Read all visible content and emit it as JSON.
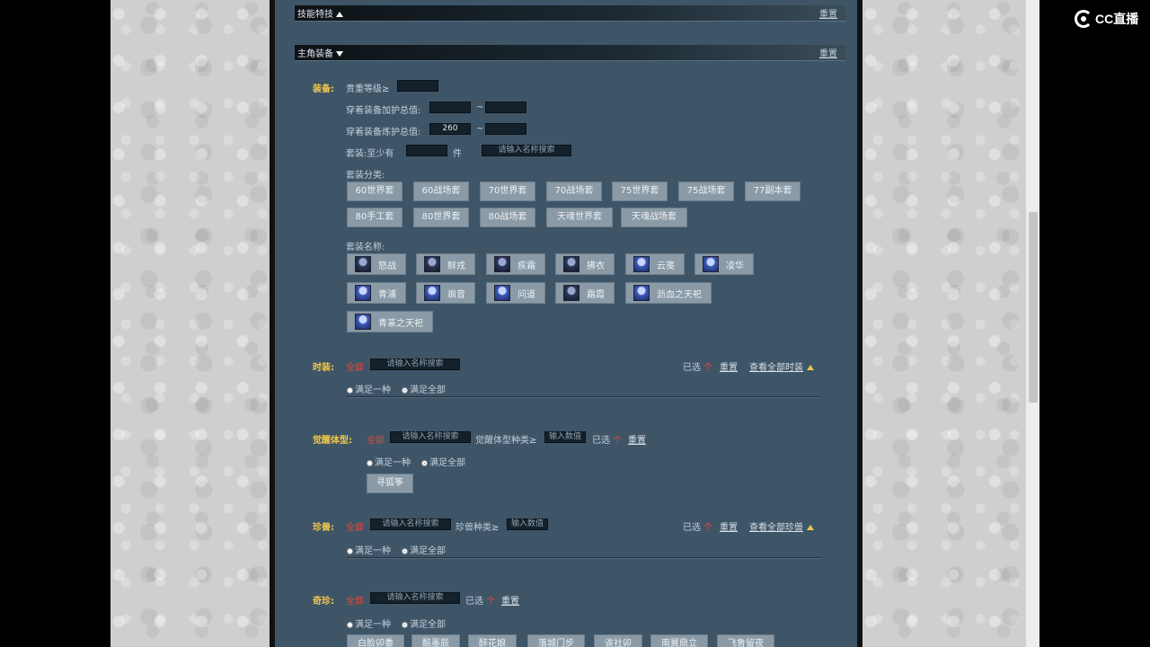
{
  "brand": {
    "name": "CC直播"
  },
  "sections": {
    "skills": {
      "title": "技能特技",
      "reset": "重置"
    },
    "equip": {
      "title": "主角装备",
      "reset": "重置"
    }
  },
  "equipment": {
    "label": "装备:",
    "row1": {
      "text": "贵重等级≥",
      "value": ""
    },
    "row2": {
      "text": "穿着装备加护总值:",
      "min": "",
      "sep": "~",
      "max": ""
    },
    "row3": {
      "text": "穿着装备炼护总值:",
      "min": "260",
      "sep": "~",
      "max": ""
    },
    "row4": {
      "text": "套装:至少有",
      "value": "",
      "unit": "件",
      "search_placeholder": "请输入名称搜索"
    },
    "category_label": "套装分类:",
    "categories": [
      "60世界套",
      "60战场套",
      "70世界套",
      "70战场套",
      "75世界套",
      "75战场套",
      "77副本套",
      "80手工套",
      "80世界套",
      "80战场套",
      "天魂世界套",
      "天魂战场套"
    ],
    "name_label": "套装名称:",
    "set_names": [
      "怒战",
      "鲜戎",
      "疾霜",
      "拂衣",
      "云笺",
      "凌华",
      "青浦",
      "飒音",
      "问道",
      "霜霞",
      "沥血之天祀",
      "青篆之天祀"
    ]
  },
  "fashion": {
    "label": "时装:",
    "all": "全部",
    "search_placeholder": "请输入名称搜索",
    "selected_prefix": "已选",
    "selected_count": "个",
    "reset": "重置",
    "view_all": "查看全部时装",
    "option_one": "满足一种",
    "option_all": "满足全部"
  },
  "awaken": {
    "label": "觉醒体型:",
    "all": "全部",
    "search_placeholder": "请输入名称搜索",
    "count_label": "觉醒体型种类≥",
    "count_placeholder": "输入数值",
    "selected_prefix": "已选",
    "selected_count": "个",
    "reset": "重置",
    "option_one": "满足一种",
    "option_all": "满足全部",
    "item": "寻狐筝"
  },
  "pets": {
    "label": "珍兽:",
    "all": "全部",
    "search_placeholder": "请输入名称搜索",
    "count_label": "珍兽种类≥",
    "count_placeholder": "输入数值",
    "selected_prefix": "已选",
    "selected_count": "个",
    "reset": "重置",
    "view_all": "查看全部珍兽",
    "option_one": "满足一种",
    "option_all": "满足全部"
  },
  "rare": {
    "label": "奇珍:",
    "all": "全部",
    "search_placeholder": "请输入名称搜索",
    "selected_prefix": "已选",
    "selected_count": "个",
    "reset": "重置",
    "option_one": "满足一种",
    "option_all": "满足全部",
    "items": [
      "白脸卯黍",
      "酩墨辰",
      "醉花娘",
      "落城门步",
      "诶社卯",
      "南翼鼎立",
      "飞鲁留夜"
    ]
  }
}
